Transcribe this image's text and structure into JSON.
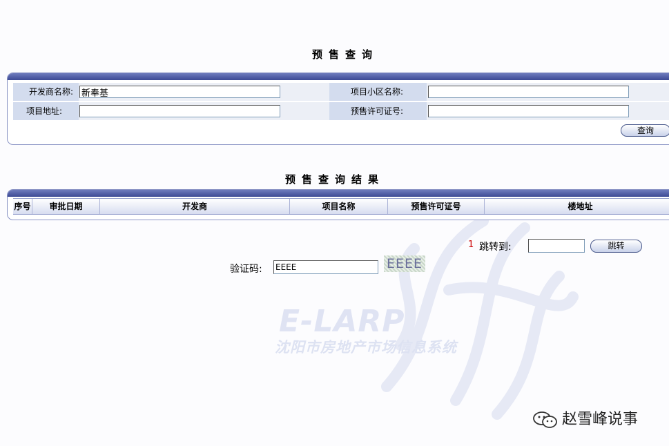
{
  "page": {
    "title": "预售查询",
    "results_title": "预售查询结果"
  },
  "search": {
    "developer_label": "开发商名称:",
    "developer_value": "新奉基",
    "project_label": "项目小区名称:",
    "project_value": "",
    "address_label": "项目地址:",
    "address_value": "",
    "permit_label": "预售许可证号:",
    "permit_value": "",
    "query_button": "查询"
  },
  "results": {
    "columns": [
      "序号",
      "审批日期",
      "开发商",
      "项目名称",
      "预售许可证号",
      "楼地址"
    ],
    "rows": []
  },
  "pager": {
    "current_page": "1",
    "jump_label": "跳转到:",
    "jump_value": "",
    "jump_button": "跳转"
  },
  "captcha": {
    "label": "验证码:",
    "input_value": "EEEE",
    "image_text": "EEEE"
  },
  "watermark": {
    "logo": "E-LARP",
    "text": "沈阳市房地产市场信息系统"
  },
  "overlay": {
    "wechat_account": "赵雪峰说事"
  },
  "colors": {
    "panel_bar": "#3d4a95",
    "label_bg": "#d3dcee",
    "page_number": "#cc0000"
  }
}
